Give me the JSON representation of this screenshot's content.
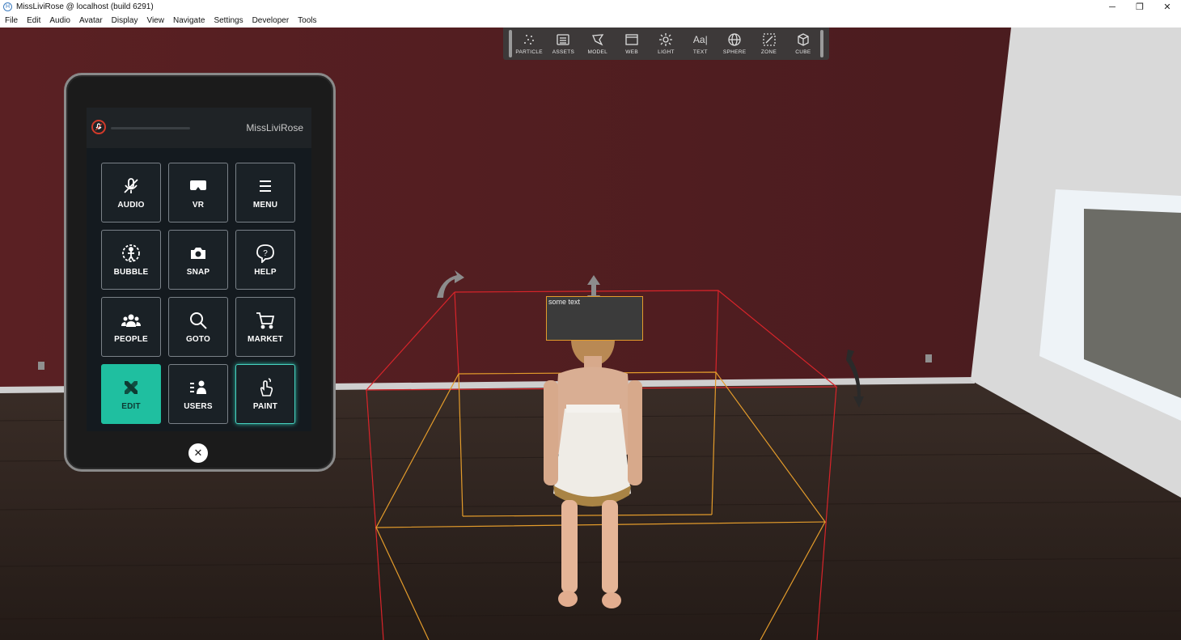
{
  "window": {
    "title": "MissLiviRose @ localhost (build 6291)",
    "controls": [
      "─",
      "❐",
      "✕"
    ]
  },
  "menu": [
    "File",
    "Edit",
    "Audio",
    "Avatar",
    "Display",
    "View",
    "Navigate",
    "Settings",
    "Developer",
    "Tools"
  ],
  "toolbar": {
    "tools": [
      {
        "label": "PARTICLE",
        "icon": "particle-icon"
      },
      {
        "label": "ASSETS",
        "icon": "assets-icon"
      },
      {
        "label": "MODEL",
        "icon": "model-icon"
      },
      {
        "label": "WEB",
        "icon": "web-icon"
      },
      {
        "label": "LIGHT",
        "icon": "light-icon"
      },
      {
        "label": "TEXT",
        "icon": "text-icon"
      },
      {
        "label": "SPHERE",
        "icon": "sphere-icon"
      },
      {
        "label": "ZONE",
        "icon": "zone-icon"
      },
      {
        "label": "CUBE",
        "icon": "cube-icon"
      }
    ],
    "text_icon_glyph": "Aa|"
  },
  "tablet": {
    "username": "MissLiviRose",
    "buttons": [
      {
        "label": "AUDIO",
        "icon": "mic-muted-icon",
        "state": "normal"
      },
      {
        "label": "VR",
        "icon": "vr-headset-icon",
        "state": "normal"
      },
      {
        "label": "MENU",
        "icon": "hamburger-icon",
        "state": "normal"
      },
      {
        "label": "BUBBLE",
        "icon": "bubble-icon",
        "state": "normal"
      },
      {
        "label": "SNAP",
        "icon": "camera-icon",
        "state": "normal"
      },
      {
        "label": "HELP",
        "icon": "help-icon",
        "state": "normal"
      },
      {
        "label": "PEOPLE",
        "icon": "people-icon",
        "state": "normal"
      },
      {
        "label": "GOTO",
        "icon": "search-icon",
        "state": "normal"
      },
      {
        "label": "MARKET",
        "icon": "cart-icon",
        "state": "normal"
      },
      {
        "label": "EDIT",
        "icon": "edit-tools-icon",
        "state": "active"
      },
      {
        "label": "USERS",
        "icon": "users-list-icon",
        "state": "normal"
      },
      {
        "label": "PAINT",
        "icon": "paint-hand-icon",
        "state": "highlighted"
      }
    ],
    "close_glyph": "✕"
  },
  "scene": {
    "text_entity": "some text",
    "colors": {
      "wall": "#4f1d1f",
      "floor": "#2c221e",
      "selection_red": "#d8242a",
      "selection_orange": "#e39b2b",
      "edit_active": "#1fbfa0"
    }
  }
}
